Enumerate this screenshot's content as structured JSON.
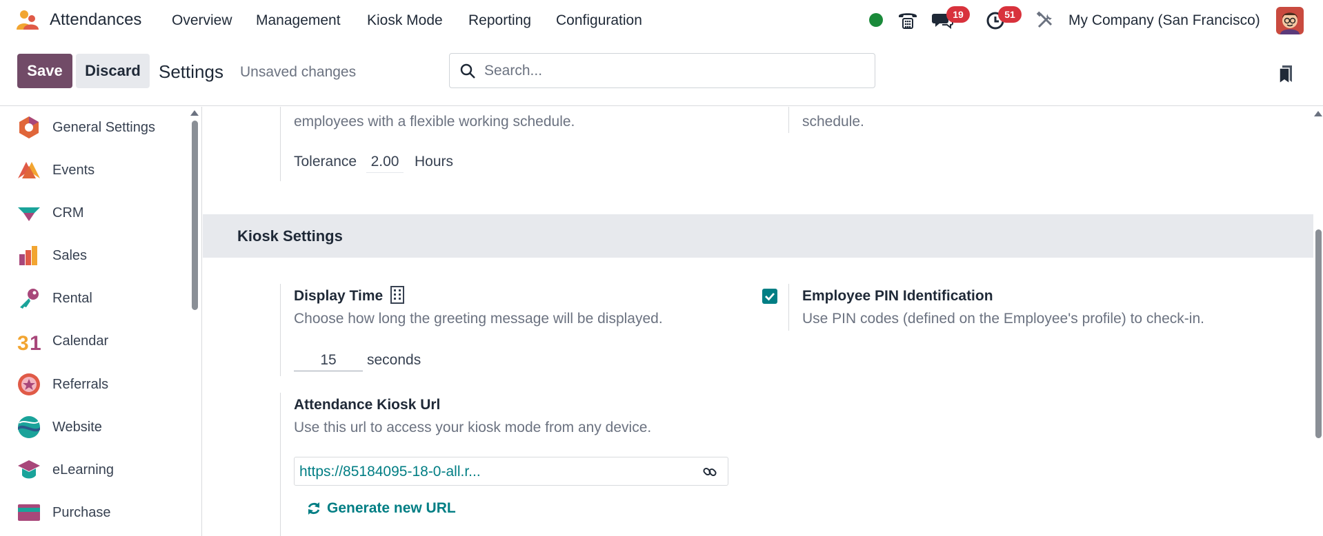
{
  "navbar": {
    "app_name": "Attendances",
    "menu": [
      "Overview",
      "Management",
      "Kiosk Mode",
      "Reporting",
      "Configuration"
    ],
    "messages_badge": "19",
    "activities_badge": "51",
    "company": "My Company (San Francisco)",
    "status_color": "#1a8a3a"
  },
  "controlbar": {
    "save_label": "Save",
    "discard_label": "Discard",
    "title": "Settings",
    "unsaved_label": "Unsaved changes",
    "search_placeholder": "Search..."
  },
  "sidebar": {
    "items": [
      {
        "label": "General Settings",
        "icon": "general-settings-icon"
      },
      {
        "label": "Events",
        "icon": "events-icon"
      },
      {
        "label": "CRM",
        "icon": "crm-icon"
      },
      {
        "label": "Sales",
        "icon": "sales-icon"
      },
      {
        "label": "Rental",
        "icon": "rental-icon"
      },
      {
        "label": "Calendar",
        "icon": "calendar-icon"
      },
      {
        "label": "Referrals",
        "icon": "referrals-icon"
      },
      {
        "label": "Website",
        "icon": "website-icon"
      },
      {
        "label": "eLearning",
        "icon": "elearning-icon"
      },
      {
        "label": "Purchase",
        "icon": "purchase-icon"
      }
    ]
  },
  "main": {
    "top_left_desc": "employees with a flexible working schedule.",
    "top_right_desc": "schedule.",
    "tolerance_label": "Tolerance",
    "tolerance_value": "2.00",
    "tolerance_unit": "Hours",
    "kiosk_section": "Kiosk Settings",
    "display_time_title": "Display Time",
    "display_time_desc": "Choose how long the greeting message will be displayed.",
    "display_time_value": "15",
    "display_time_unit": "seconds",
    "pin_title": "Employee PIN Identification",
    "pin_desc": "Use PIN codes (defined on the Employee's profile) to check-in.",
    "pin_checked": true,
    "kiosk_url_title": "Attendance Kiosk Url",
    "kiosk_url_desc": "Use this url to access your kiosk mode from any device.",
    "kiosk_url_value": "https://85184095-18-0-all.r...",
    "generate_url_label": "Generate new URL"
  },
  "colors": {
    "primary": "#714b67",
    "accent": "#017e84",
    "badge": "#d8323c"
  }
}
